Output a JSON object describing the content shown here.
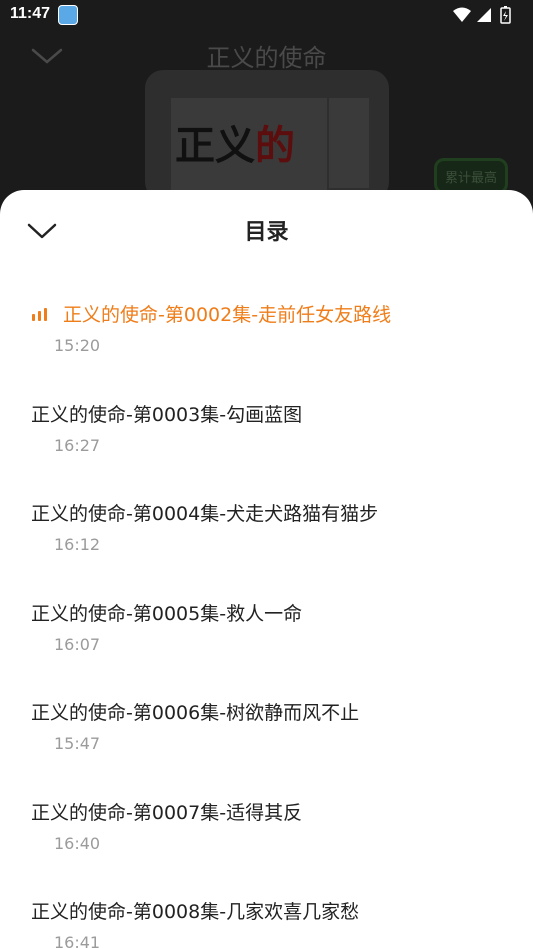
{
  "status_bar": {
    "time": "11:47"
  },
  "player": {
    "title": "正义的使命",
    "rank_badge": "累计最高",
    "poster_text_main": "正义",
    "poster_text_accent": "的"
  },
  "sheet": {
    "title": "目录",
    "episodes": [
      {
        "title": "正义的使命-第0002集-走前任女友路线",
        "duration": "15:20",
        "active": true
      },
      {
        "title": "正义的使命-第0003集-勾画蓝图",
        "duration": "16:27"
      },
      {
        "title": "正义的使命-第0004集-犬走犬路猫有猫步",
        "duration": "16:12"
      },
      {
        "title": "正义的使命-第0005集-救人一命",
        "duration": "16:07"
      },
      {
        "title": "正义的使命-第0006集-树欲静而风不止",
        "duration": "15:47"
      },
      {
        "title": "正义的使命-第0007集-适得其反",
        "duration": "16:40"
      },
      {
        "title": "正义的使命-第0008集-几家欢喜几家愁",
        "duration": "16:41"
      }
    ]
  },
  "colors": {
    "accent": "#ef7d1a",
    "text": "#222222",
    "muted": "#9b9b9b"
  }
}
